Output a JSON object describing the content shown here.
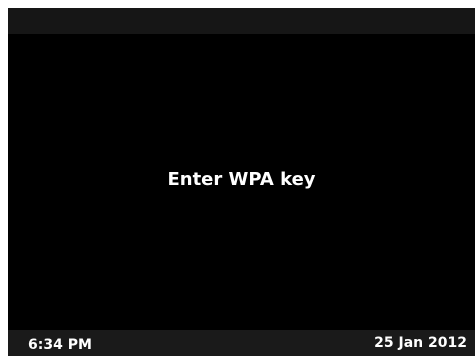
{
  "screen": {
    "prompt": "Enter WPA key"
  },
  "status_bar": {
    "time": "6:34 PM",
    "date": "25 Jan 2012"
  },
  "colors": {
    "background": "#000000",
    "top_bar": "#161616",
    "status_bar": "#1a1a1a",
    "text": "#ffffff"
  }
}
